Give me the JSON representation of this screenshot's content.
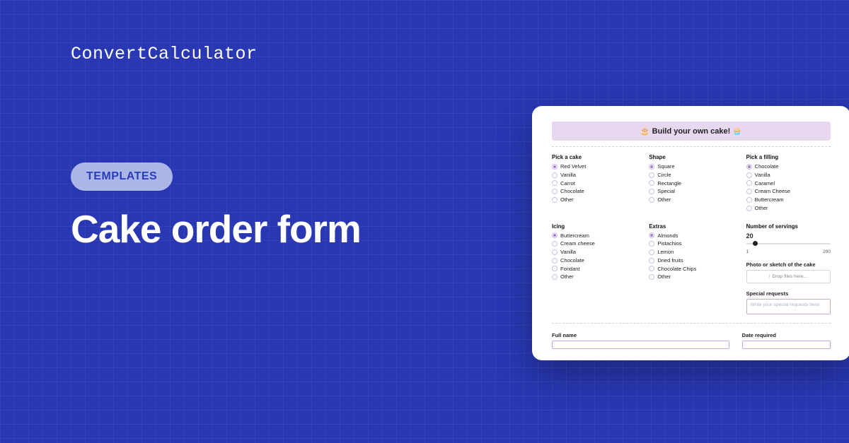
{
  "brand": "ConvertCalculator",
  "pill_label": "TEMPLATES",
  "headline": "Cake order form",
  "preview": {
    "title": "🎂 Build your own cake! 🧁",
    "groups": {
      "cake": {
        "label": "Pick a cake",
        "options": [
          "Red Velvet",
          "Vanilla",
          "Carrot",
          "Chocolate",
          "Other"
        ],
        "selected_index": 0
      },
      "shape": {
        "label": "Shape",
        "options": [
          "Square",
          "Circle",
          "Rectangle",
          "Special",
          "Other"
        ],
        "selected_index": 0
      },
      "filling": {
        "label": "Pick a filling",
        "options": [
          "Chocolate",
          "Vanilla",
          "Caramel",
          "Cream Cheese",
          "Buttercream",
          "Other"
        ],
        "selected_index": 0
      },
      "icing": {
        "label": "Icing",
        "options": [
          "Buttercream",
          "Cream cheese",
          "Vanilla",
          "Chocolate",
          "Fondant",
          "Other"
        ],
        "selected_index": 0
      },
      "extras": {
        "label": "Extras",
        "options": [
          "Almonds",
          "Pistachios",
          "Lemon",
          "Dried fruits",
          "Chocolate Chips",
          "Other"
        ],
        "selected_index": 0
      }
    },
    "servings": {
      "label": "Number of servings",
      "value": "20",
      "min": "1",
      "max": "200"
    },
    "photo": {
      "label": "Photo or sketch of the cake",
      "placeholder": "↑ Drop files here…"
    },
    "requests": {
      "label": "Special requests",
      "placeholder": "Write your special requests here"
    },
    "full_name_label": "Full name",
    "date_required_label": "Date required"
  }
}
